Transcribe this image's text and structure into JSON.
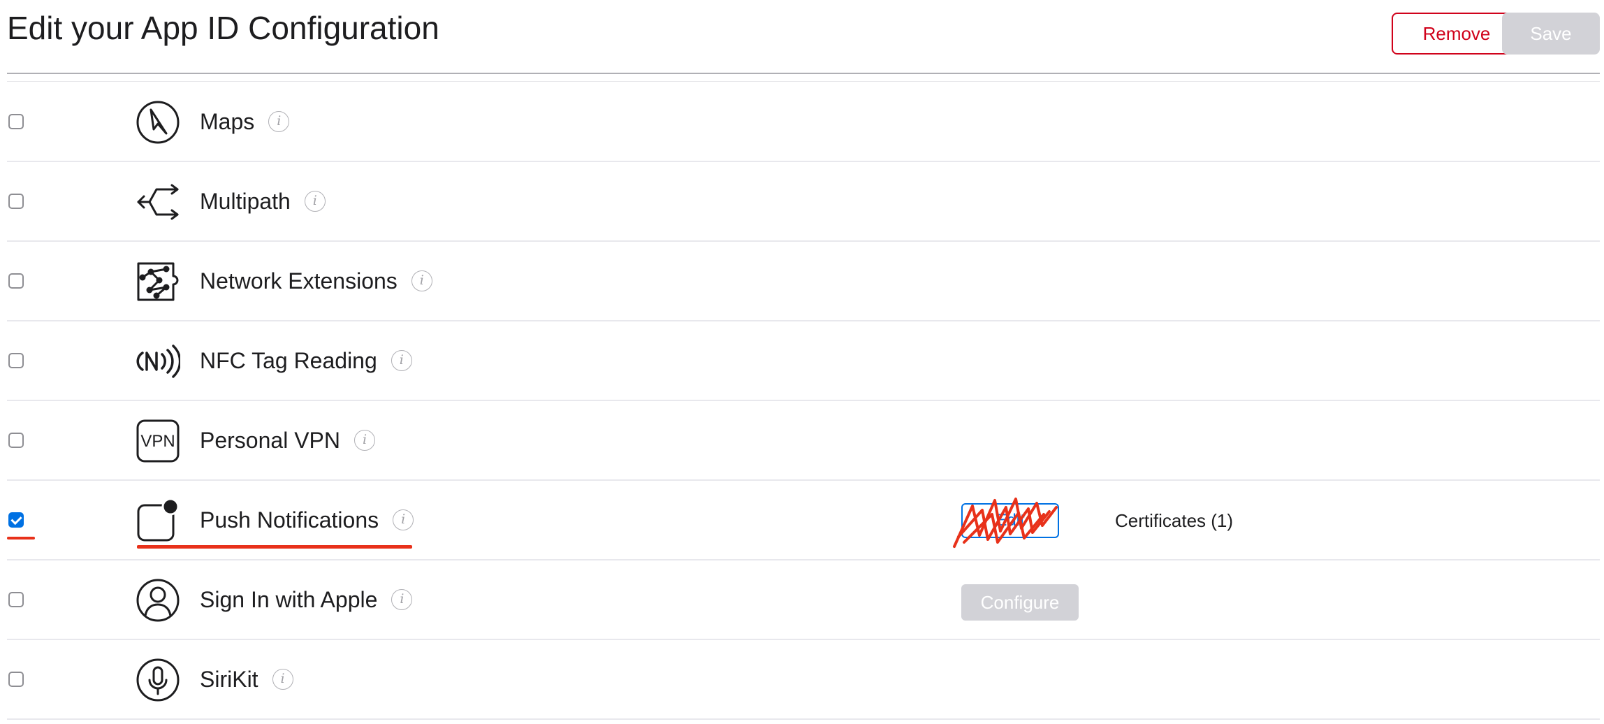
{
  "header": {
    "title": "Edit your App ID Configuration",
    "remove_label": "Remove",
    "save_label": "Save"
  },
  "capabilities": [
    {
      "label": "Maps",
      "checked": false,
      "icon": "compass-icon"
    },
    {
      "label": "Multipath",
      "checked": false,
      "icon": "multipath-arrows-icon"
    },
    {
      "label": "Network Extensions",
      "checked": false,
      "icon": "puzzle-network-icon"
    },
    {
      "label": "NFC Tag Reading",
      "checked": false,
      "icon": "nfc-icon"
    },
    {
      "label": "Personal VPN",
      "checked": false,
      "icon": "vpn-icon"
    },
    {
      "label": "Push Notifications",
      "checked": true,
      "icon": "notification-badge-icon",
      "action_label": "Edit",
      "certificates_text": "Certificates (1)"
    },
    {
      "label": "Sign In with Apple",
      "checked": false,
      "icon": "person-icon",
      "action_label": "Configure"
    },
    {
      "label": "SiriKit",
      "checked": false,
      "icon": "microphone-icon"
    }
  ],
  "info_glyph": "i",
  "colors": {
    "accent_blue": "#0071e3",
    "remove_red": "#d0021b",
    "disabled_gray": "#d2d2d7",
    "annotation_red": "#e8311a"
  }
}
